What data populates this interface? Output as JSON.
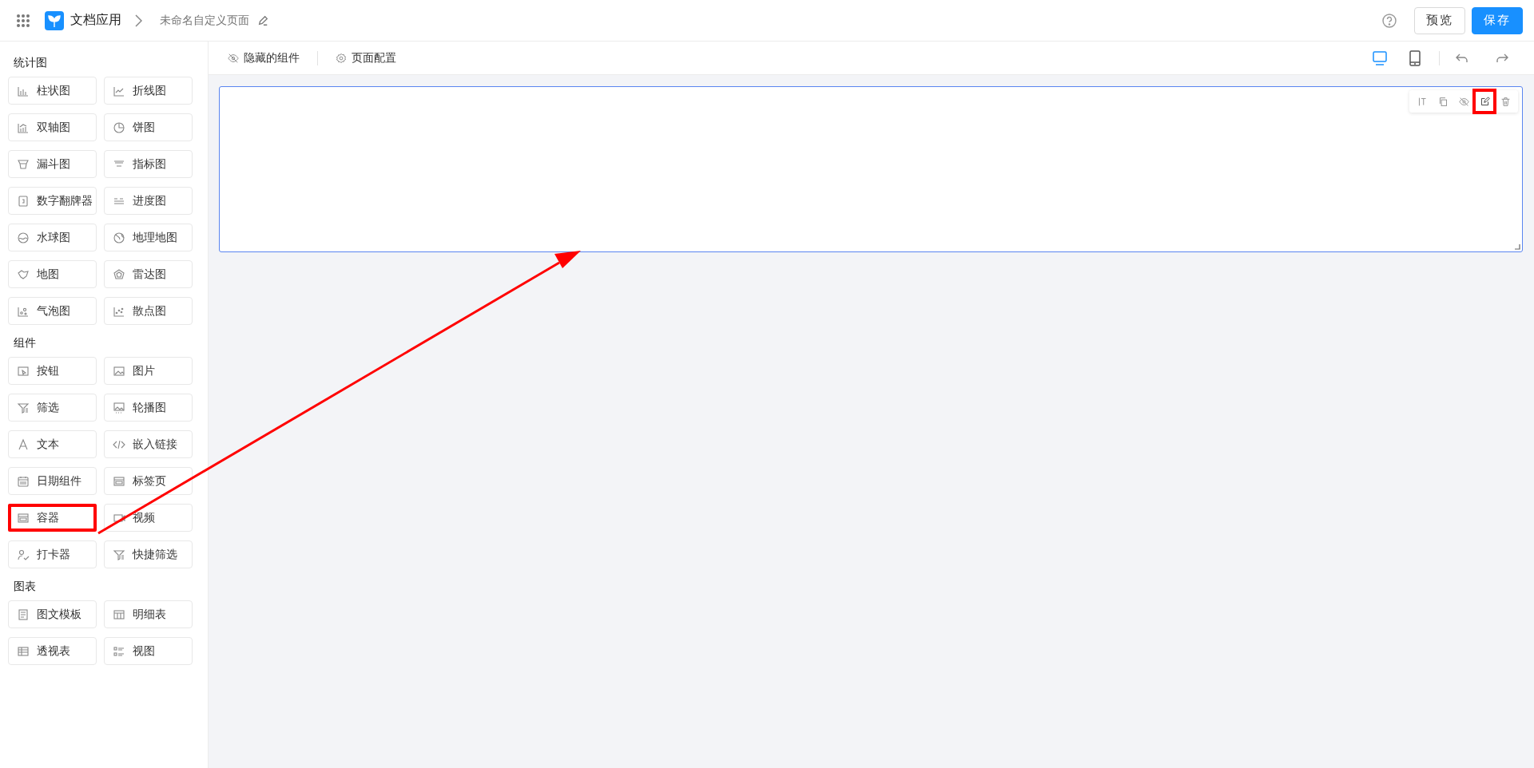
{
  "header": {
    "app_name": "文档应用",
    "page_name": "未命名自定义页面",
    "buttons": [
      {
        "label": "预览",
        "kind": "default"
      },
      {
        "label": "保存",
        "kind": "primary"
      }
    ]
  },
  "toolbar": {
    "actions": [
      {
        "label": "隐藏的组件"
      },
      {
        "label": "页面配置"
      }
    ],
    "devices": [
      {
        "selected": true
      },
      {
        "selected": false
      }
    ]
  },
  "sections": [
    {
      "title": "统计图",
      "items": [
        {
          "label": "柱状图",
          "highlighted": false
        },
        {
          "label": "折线图",
          "highlighted": false
        },
        {
          "label": "双轴图",
          "highlighted": false
        },
        {
          "label": "饼图",
          "highlighted": false
        },
        {
          "label": "漏斗图",
          "highlighted": false
        },
        {
          "label": "指标图",
          "highlighted": false
        },
        {
          "label": "数字翻牌器",
          "highlighted": false
        },
        {
          "label": "进度图",
          "highlighted": false
        },
        {
          "label": "水球图",
          "highlighted": false
        },
        {
          "label": "地理地图",
          "highlighted": false
        },
        {
          "label": "地图",
          "highlighted": false
        },
        {
          "label": "雷达图",
          "highlighted": false
        },
        {
          "label": "气泡图",
          "highlighted": false
        },
        {
          "label": "散点图",
          "highlighted": false
        }
      ]
    },
    {
      "title": "组件",
      "items": [
        {
          "label": "按钮",
          "highlighted": false
        },
        {
          "label": "图片",
          "highlighted": false
        },
        {
          "label": "筛选",
          "highlighted": false
        },
        {
          "label": "轮播图",
          "highlighted": false
        },
        {
          "label": "文本",
          "highlighted": false
        },
        {
          "label": "嵌入链接",
          "highlighted": false
        },
        {
          "label": "日期组件",
          "highlighted": false
        },
        {
          "label": "标签页",
          "highlighted": false
        },
        {
          "label": "容器",
          "highlighted": true
        },
        {
          "label": "视频",
          "highlighted": false
        },
        {
          "label": "打卡器",
          "highlighted": false
        },
        {
          "label": "快捷筛选",
          "highlighted": false
        }
      ]
    },
    {
      "title": "图表",
      "items": [
        {
          "label": "图文模板",
          "highlighted": false
        },
        {
          "label": "明细表",
          "highlighted": false
        },
        {
          "label": "透视表",
          "highlighted": false
        },
        {
          "label": "视图",
          "highlighted": false
        }
      ]
    }
  ],
  "canvas": {
    "block_tools": [
      {
        "highlighted": false
      },
      {
        "highlighted": false
      },
      {
        "highlighted": false
      },
      {
        "highlighted": true
      },
      {
        "highlighted": false
      }
    ]
  }
}
